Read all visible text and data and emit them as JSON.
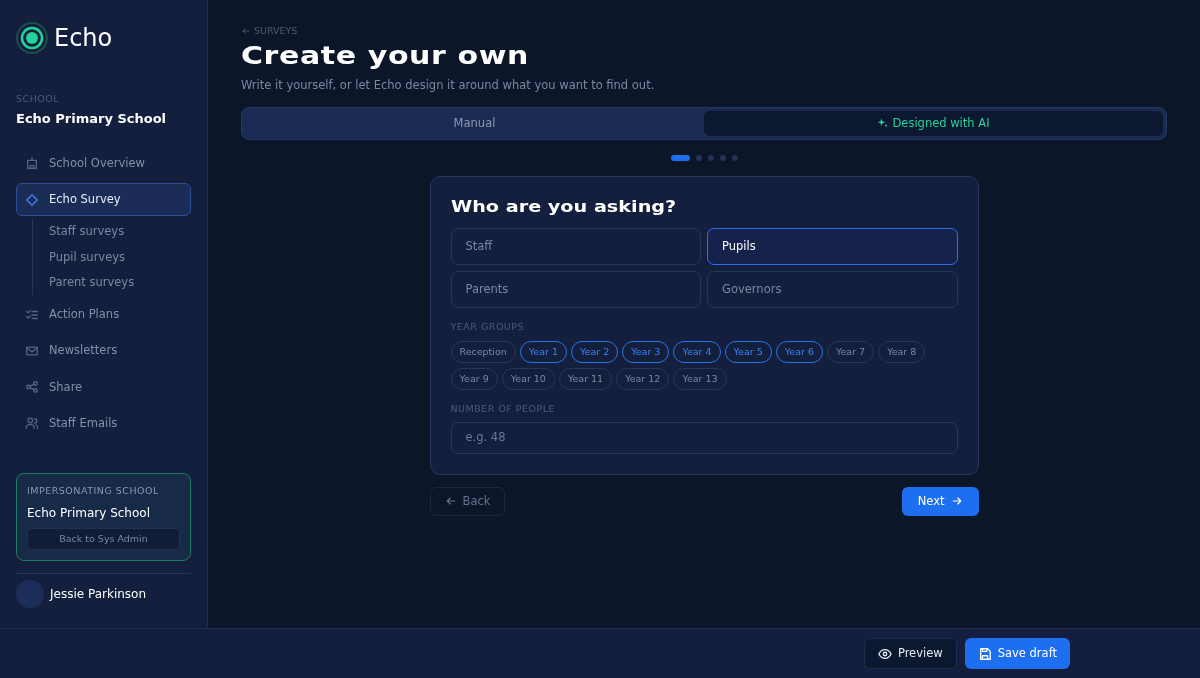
{
  "brand": {
    "name": "Echo"
  },
  "school": {
    "label": "SCHOOL",
    "name": "Echo Primary School"
  },
  "sidebar": {
    "items": [
      {
        "label": "School Overview",
        "kind": "building",
        "selected": false
      },
      {
        "label": "Echo Survey",
        "kind": "diamond",
        "selected": true,
        "children": [
          {
            "label": "Staff surveys"
          },
          {
            "label": "Pupil surveys"
          },
          {
            "label": "Parent surveys"
          }
        ]
      },
      {
        "label": "Action Plans",
        "kind": "checklist",
        "selected": false
      },
      {
        "label": "Newsletters",
        "kind": "mail",
        "selected": false
      },
      {
        "label": "Share",
        "kind": "share",
        "selected": false
      },
      {
        "label": "Staff Emails",
        "kind": "people",
        "selected": false
      }
    ]
  },
  "impersonation": {
    "label": "IMPERSONATING SCHOOL",
    "school": "Echo Primary School",
    "button": "Back to Sys Admin"
  },
  "user": {
    "name": "Jessie Parkinson"
  },
  "breadcrumb": "SURVEYS",
  "title": "Create your own",
  "subtitle": "Write it yourself, or let Echo design it around what you want to find out.",
  "modes": [
    {
      "label": "Manual",
      "selected": false
    },
    {
      "label": "Designed with AI",
      "selected": true
    }
  ],
  "steps": [
    {
      "selected": true
    },
    {
      "selected": false
    },
    {
      "selected": false
    },
    {
      "selected": false
    },
    {
      "selected": false
    }
  ],
  "card": {
    "heading": "Who are you asking?",
    "audiences": [
      {
        "label": "Staff",
        "selected": false
      },
      {
        "label": "Pupils",
        "selected": true
      },
      {
        "label": "Parents",
        "selected": false
      },
      {
        "label": "Governors",
        "selected": false
      }
    ],
    "year_groups_label": "YEAR GROUPS",
    "year_groups": [
      {
        "label": "Reception",
        "selected": false
      },
      {
        "label": "Year 1",
        "selected": true
      },
      {
        "label": "Year 2",
        "selected": true
      },
      {
        "label": "Year 3",
        "selected": true
      },
      {
        "label": "Year 4",
        "selected": true
      },
      {
        "label": "Year 5",
        "selected": true
      },
      {
        "label": "Year 6",
        "selected": true
      },
      {
        "label": "Year 7",
        "selected": false
      },
      {
        "label": "Year 8",
        "selected": false
      },
      {
        "label": "Year 9",
        "selected": false
      },
      {
        "label": "Year 10",
        "selected": false
      },
      {
        "label": "Year 11",
        "selected": false
      },
      {
        "label": "Year 12",
        "selected": false
      },
      {
        "label": "Year 13",
        "selected": false
      }
    ],
    "people_label": "NUMBER OF PEOPLE",
    "people_placeholder": "e.g. 48"
  },
  "nav": {
    "back": "Back",
    "next": "Next"
  },
  "footer": {
    "preview": "Preview",
    "save": "Save draft"
  }
}
